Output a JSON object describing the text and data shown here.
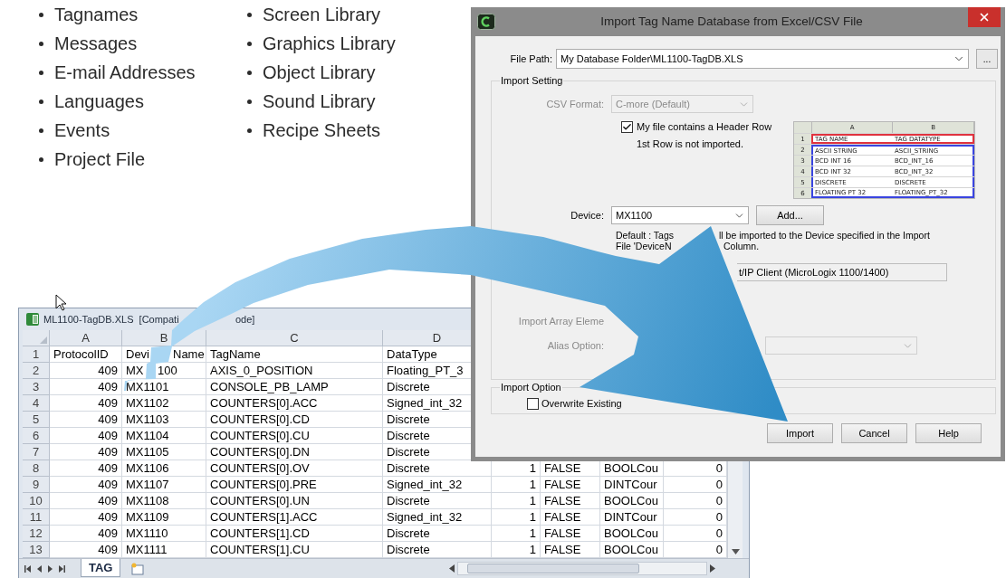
{
  "bullet_list": {
    "columns": [
      [
        "Tagnames",
        "Messages",
        "E-mail Addresses",
        "Languages",
        "Events",
        "Project File"
      ],
      [
        "Screen Library",
        "Graphics Library",
        "Object Library",
        "Sound Library",
        "Recipe Sheets"
      ]
    ]
  },
  "spreadsheet": {
    "title": [
      "ML1100-TagDB.XLS  [Compati",
      "ode]"
    ],
    "columns": [
      "A",
      "B",
      "C",
      "D"
    ],
    "rows": [
      {
        "number": "1",
        "a": "ProtocolID",
        "b": [
          "Devi",
          "Name"
        ],
        "c": "TagName",
        "d": "DataType"
      },
      {
        "number": "2",
        "a": "409",
        "b": [
          "MX",
          "100"
        ],
        "c": "AXIS_0_POSITION",
        "d": "Floating_PT_3"
      },
      {
        "number": "3",
        "a": "409",
        "b": [
          "MX1101"
        ],
        "c": "CONSOLE_PB_LAMP",
        "d": "Discrete"
      },
      {
        "number": "4",
        "a": "409",
        "b": [
          "MX1102"
        ],
        "c": "COUNTERS[0].ACC",
        "d": "Signed_int_32"
      },
      {
        "number": "5",
        "a": "409",
        "b": [
          "MX1103"
        ],
        "c": "COUNTERS[0].CD",
        "d": "Discrete"
      },
      {
        "number": "6",
        "a": "409",
        "b": [
          "MX1104"
        ],
        "c": "COUNTERS[0].CU",
        "d": "Discrete"
      },
      {
        "number": "7",
        "a": "409",
        "b": [
          "MX1105"
        ],
        "c": "COUNTERS[0].DN",
        "d": "Discrete"
      },
      {
        "number": "8",
        "a": "409",
        "b": [
          "MX1106"
        ],
        "c": "COUNTERS[0].OV",
        "d": "Discrete",
        "e": "1",
        "f": "FALSE",
        "g": "BOOLCou",
        "h": "0"
      },
      {
        "number": "9",
        "a": "409",
        "b": [
          "MX1107"
        ],
        "c": "COUNTERS[0].PRE",
        "d": "Signed_int_32",
        "e": "1",
        "f": "FALSE",
        "g": "DINTCour",
        "h": "0"
      },
      {
        "number": "10",
        "a": "409",
        "b": [
          "MX1108"
        ],
        "c": "COUNTERS[0].UN",
        "d": "Discrete",
        "e": "1",
        "f": "FALSE",
        "g": "BOOLCou",
        "h": "0"
      },
      {
        "number": "11",
        "a": "409",
        "b": [
          "MX1109"
        ],
        "c": "COUNTERS[1].ACC",
        "d": "Signed_int_32",
        "e": "1",
        "f": "FALSE",
        "g": "DINTCour",
        "h": "0"
      },
      {
        "number": "12",
        "a": "409",
        "b": [
          "MX1110"
        ],
        "c": "COUNTERS[1].CD",
        "d": "Discrete",
        "e": "1",
        "f": "FALSE",
        "g": "BOOLCou",
        "h": "0"
      },
      {
        "number": "13",
        "a": "409",
        "b": [
          "MX1111"
        ],
        "c": "COUNTERS[1].CU",
        "d": "Discrete",
        "e": "1",
        "f": "FALSE",
        "g": "BOOLCou",
        "h": "0"
      }
    ],
    "sheet_tabs": [
      {
        "label": "TAG",
        "selected": true
      }
    ]
  },
  "dialog": {
    "title": "Import Tag Name Database from Excel/CSV File",
    "file_path": {
      "label": "File Path:",
      "value": "My Database Folder\\ML1100-TagDB.XLS"
    },
    "browse_button": "...",
    "import_setting": {
      "legend": "Import Setting",
      "csv_format": {
        "label": "CSV Format:",
        "value": "C-more (Default)",
        "disabled": true
      },
      "header_row": {
        "label": "My file contains a Header Row",
        "checked": true,
        "note": "1st Row is not imported."
      },
      "preview": {
        "columns": [
          "A",
          "B"
        ],
        "rows": [
          {
            "number": "1",
            "a": "TAG NAME",
            "b": "TAG DATATYPE",
            "kind": "header"
          },
          {
            "number": "2",
            "a": "ASCII STRING",
            "b": "ASCII_STRING",
            "kind": "data"
          },
          {
            "number": "3",
            "a": "BCD INT 16",
            "b": "BCD_INT_16",
            "kind": "data"
          },
          {
            "number": "4",
            "a": "BCD INT 32",
            "b": "BCD_INT_32",
            "kind": "data"
          },
          {
            "number": "5",
            "a": "DISCRETE",
            "b": "DISCRETE",
            "kind": "data"
          },
          {
            "number": "6",
            "a": "FLOATING PT 32",
            "b": "FLOATING_PT_32",
            "kind": "data"
          }
        ]
      },
      "device": {
        "label": "Device:",
        "value": "MX1100"
      },
      "add_button": "Add...",
      "default_note": [
        [
          "Default : Tags",
          "ll be imported to the Device specified in the Import"
        ],
        [
          "File 'DeviceN",
          "Column."
        ]
      ],
      "driver": {
        "value": "t/IP Client (MicroLogix 1100/1400)"
      },
      "array_element": {
        "label": "Import Array Eleme",
        "disabled": true
      },
      "alias_option": {
        "label": "Alias Option:",
        "disabled": true
      }
    },
    "import_option": {
      "legend": "Import Option",
      "overwrite": {
        "label": "Overwrite Existing",
        "checked": false
      }
    },
    "buttons": [
      "Import",
      "Cancel",
      "Help"
    ]
  }
}
